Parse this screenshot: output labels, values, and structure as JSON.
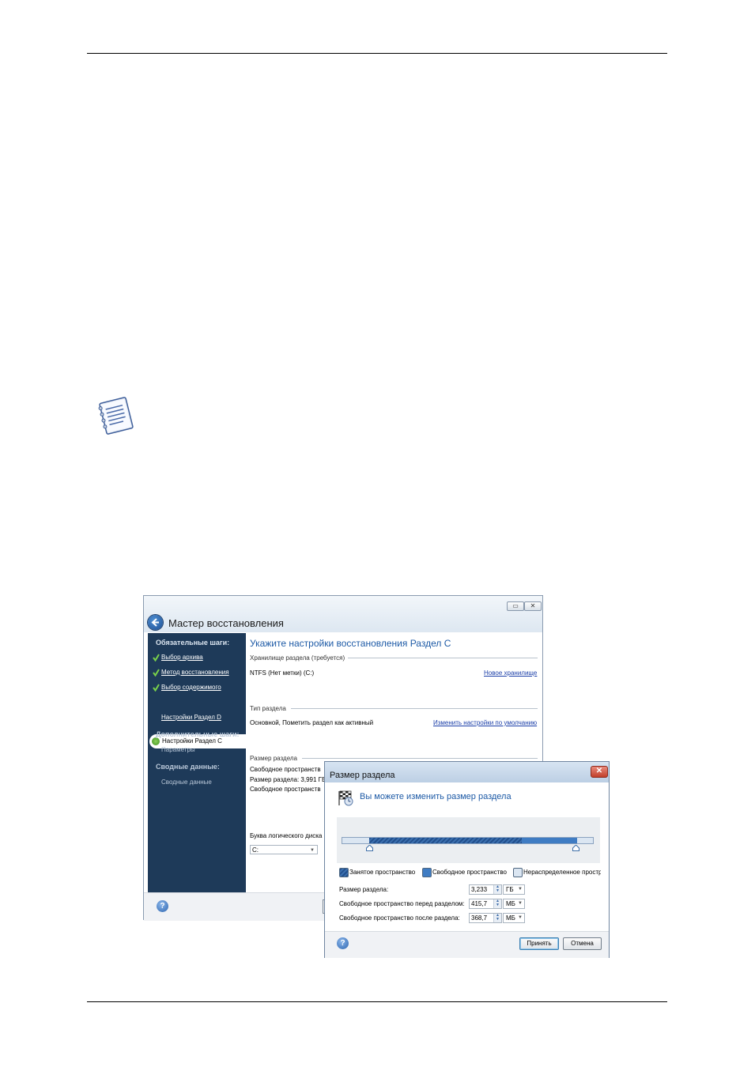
{
  "wizard": {
    "title": "Мастер восстановления",
    "sidebar": {
      "required_header": "Обязательные шаги:",
      "required_items": [
        "Выбор архива",
        "Метод восстановления",
        "Выбор содержимого"
      ],
      "current_item": "Настройки Раздел C",
      "next_item": "Настройки Раздел D",
      "optional_header": "Дополнительные шаги:",
      "optional_item": "Параметры",
      "summary_header": "Сводные данные:",
      "summary_item": "Сводные данные"
    },
    "heading": "Укажите настройки восстановления Раздел C",
    "storage": {
      "section": "Хранилище раздела (требуется)",
      "value": "NTFS (Нет метки) (C:)",
      "link": "Новое хранилище"
    },
    "type": {
      "section": "Тип раздела",
      "value": "Основной, Пометить раздел как активный",
      "link": "Изменить настройки по умолчанию"
    },
    "size": {
      "section": "Размер раздела",
      "line1": "Свободное пространств",
      "line2": "Размер раздела: 3,991 ГБ",
      "line3": "Свободное пространств"
    },
    "drive_letter": {
      "label": "Буква логического диска",
      "value": "C:"
    }
  },
  "dialog": {
    "title": "Размер раздела",
    "heading": "Вы можете изменить размер раздела",
    "bar": {
      "free_before_fraction": 0.107,
      "partition_fraction": 0.83,
      "used_fraction": 0.61
    },
    "legend": {
      "used": "Занятое пространство",
      "free": "Свободное пространство",
      "unallocated": "Нераспределенное простр"
    },
    "fields": [
      {
        "label": "Размер раздела:",
        "value": "3,233",
        "unit": "ГБ"
      },
      {
        "label": "Свободное пространство перед разделом:",
        "value": "415,7",
        "unit": "МБ"
      },
      {
        "label": "Свободное пространство после раздела:",
        "value": "368,7",
        "unit": "МБ"
      }
    ],
    "ok_label": "Принять",
    "cancel_label": "Отмена"
  },
  "colors": {
    "sidebar_bg": "#1e3a59",
    "heading_blue": "#1d5aa6",
    "partition_blue": "#3f7cc3"
  }
}
